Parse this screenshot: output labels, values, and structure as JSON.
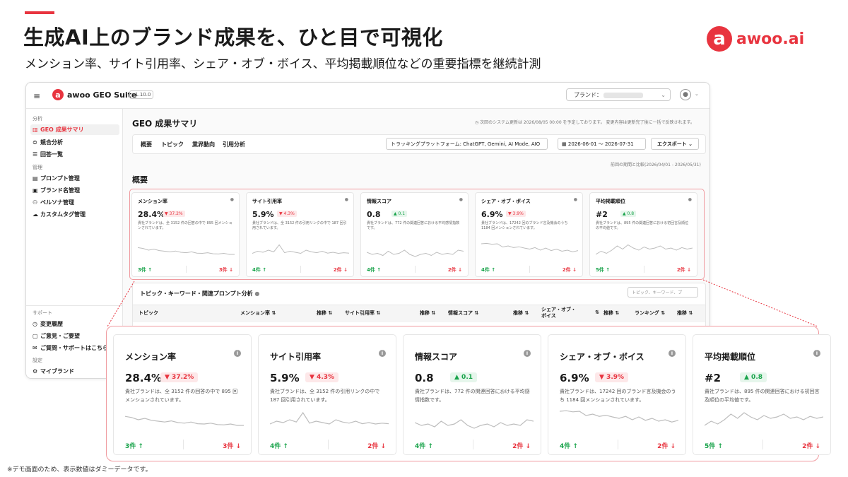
{
  "slide": {
    "headline": "生成AI上のブランド成果を、ひと目で可視化",
    "subline": "メンション率、サイト引用率、シェア・オブ・ボイス、平均掲載順位などの重要指標を継続計測",
    "brand_mark": "a",
    "brand_word": "awoo.ai",
    "footnote": "※デモ画面のため、表示数値はダミーデータです。",
    "colors": {
      "accent": "#e8343f",
      "positive": "#18a34a",
      "outline": "#f09a9f"
    }
  },
  "app": {
    "menu_icon": "≡",
    "logo_mark": "a",
    "name": "awoo GEO Suite",
    "version": "v1.10.0",
    "brand_label": "ブランド：",
    "user_icon": "user-circle-icon",
    "sidebar": {
      "section_analysis": "分析",
      "section_manage": "管理",
      "section_support": "サポート",
      "section_settings": "設定",
      "items": [
        {
          "icon": "▥",
          "label": "GEO 成果サマリ"
        },
        {
          "icon": "⊜",
          "label": "競合分析"
        },
        {
          "icon": "☰",
          "label": "回答一覧"
        },
        {
          "icon": "▤",
          "label": "プロンプト管理"
        },
        {
          "icon": "▣",
          "label": "ブランド名管理"
        },
        {
          "icon": "⚇",
          "label": "ペルソナ管理"
        },
        {
          "icon": "☁",
          "label": "カスタムタグ管理"
        },
        {
          "icon": "◷",
          "label": "変更履歴"
        },
        {
          "icon": "▢",
          "label": "ご意見・ご要望"
        },
        {
          "icon": "✉",
          "label": "ご質問・サポートはこちら"
        },
        {
          "icon": "⚙",
          "label": "マイブランド"
        }
      ]
    },
    "main": {
      "page_title": "GEO 成果サマリ",
      "notice": "◷ 次回のシステム更新は 2026/08/05 00:00 を予定しております。 変更内容は更新完了後に一括で反映されます。",
      "tabs": [
        "概要",
        "トピック",
        "業界動向",
        "引用分析"
      ],
      "platform_filter": "トラッキングプラットフォーム: ChatGPT, Gemini, AI Mode, AIO",
      "date_icon": "calendar-icon",
      "date_from": "2026-06-01",
      "date_sep": "～",
      "date_to": "2026-07-31",
      "export_label": "エクスポート ⌄",
      "compare_note": "前回の期間と比較(2026/04/01 - 2026/05/31)",
      "overview_title": "概要",
      "topic_title": "トピック・キーワード・関連プロンプト分析",
      "topic_search_placeholder": "トピック、キーワード、プ",
      "table_headers": [
        "トピック",
        "メンション率 ⇅",
        "推移 ⇅",
        "サイト引用率 ⇅",
        "推移 ⇅",
        "情報スコア ⇅",
        "推移 ⇅",
        "シェア・オブ・ボイス",
        "⇅",
        "推移 ⇅",
        "ランキング ⇅",
        "推移 ⇅"
      ]
    }
  },
  "metrics": [
    {
      "title": "メンション率",
      "value": "28.4%",
      "change": "▼ 37.2%",
      "direction": "down",
      "desc": "貴社ブランドは、全 3152 件の回答の中で 895 回メンションされています。",
      "up_count": "3件 ↑",
      "down_count": "3件 ↓",
      "spark": [
        0.62,
        0.58,
        0.5,
        0.55,
        0.48,
        0.45,
        0.42,
        0.46,
        0.4,
        0.38,
        0.42,
        0.36,
        0.35,
        0.38,
        0.33,
        0.32,
        0.35,
        0.3,
        0.3
      ]
    },
    {
      "title": "サイト引用率",
      "value": "5.9%",
      "change": "▼ 4.3%",
      "direction": "down",
      "desc": "貴社ブランドは、全 3152 件の引用リンクの中で 187 回引用されています。",
      "up_count": "4件 ↑",
      "down_count": "2件 ↓",
      "spark": [
        0.35,
        0.45,
        0.4,
        0.5,
        0.42,
        0.75,
        0.38,
        0.45,
        0.4,
        0.35,
        0.5,
        0.42,
        0.38,
        0.45,
        0.36,
        0.4,
        0.35,
        0.38,
        0.36
      ]
    },
    {
      "title": "情報スコア",
      "value": "0.8",
      "change": "▲ 0.1",
      "direction": "up",
      "desc": "貴社ブランドは、772 件の関連回答における平均感情指数です。",
      "up_count": "4件 ↑",
      "down_count": "2件 ↓",
      "spark": [
        0.4,
        0.3,
        0.35,
        0.25,
        0.45,
        0.3,
        0.35,
        0.5,
        0.3,
        0.2,
        0.3,
        0.35,
        0.25,
        0.4,
        0.3,
        0.35,
        0.3,
        0.5,
        0.45
      ]
    },
    {
      "title": "シェア・オブ・ボイス",
      "value": "6.9%",
      "change": "▼ 3.9%",
      "direction": "down",
      "desc": "貴社ブランドは、17242 回のブランド言及機会のうち 1184 回メンションされています。",
      "up_count": "4件 ↑",
      "down_count": "2件 ↓",
      "spark": [
        0.8,
        0.82,
        0.78,
        0.8,
        0.65,
        0.7,
        0.62,
        0.66,
        0.6,
        0.55,
        0.62,
        0.5,
        0.6,
        0.48,
        0.55,
        0.45,
        0.5,
        0.42,
        0.48
      ]
    },
    {
      "title": "平均掲載順位",
      "value": "#2",
      "change": "▲ 0.8",
      "direction": "up",
      "desc": "貴社ブランドは、895 件の関連回答における初回言及順位の平均値です。",
      "up_count": "5件 ↑",
      "down_count": "2件 ↓",
      "spark": [
        0.3,
        0.45,
        0.35,
        0.5,
        0.7,
        0.55,
        0.75,
        0.6,
        0.5,
        0.65,
        0.55,
        0.6,
        0.7,
        0.55,
        0.6,
        0.5,
        0.62,
        0.55,
        0.6
      ]
    }
  ]
}
